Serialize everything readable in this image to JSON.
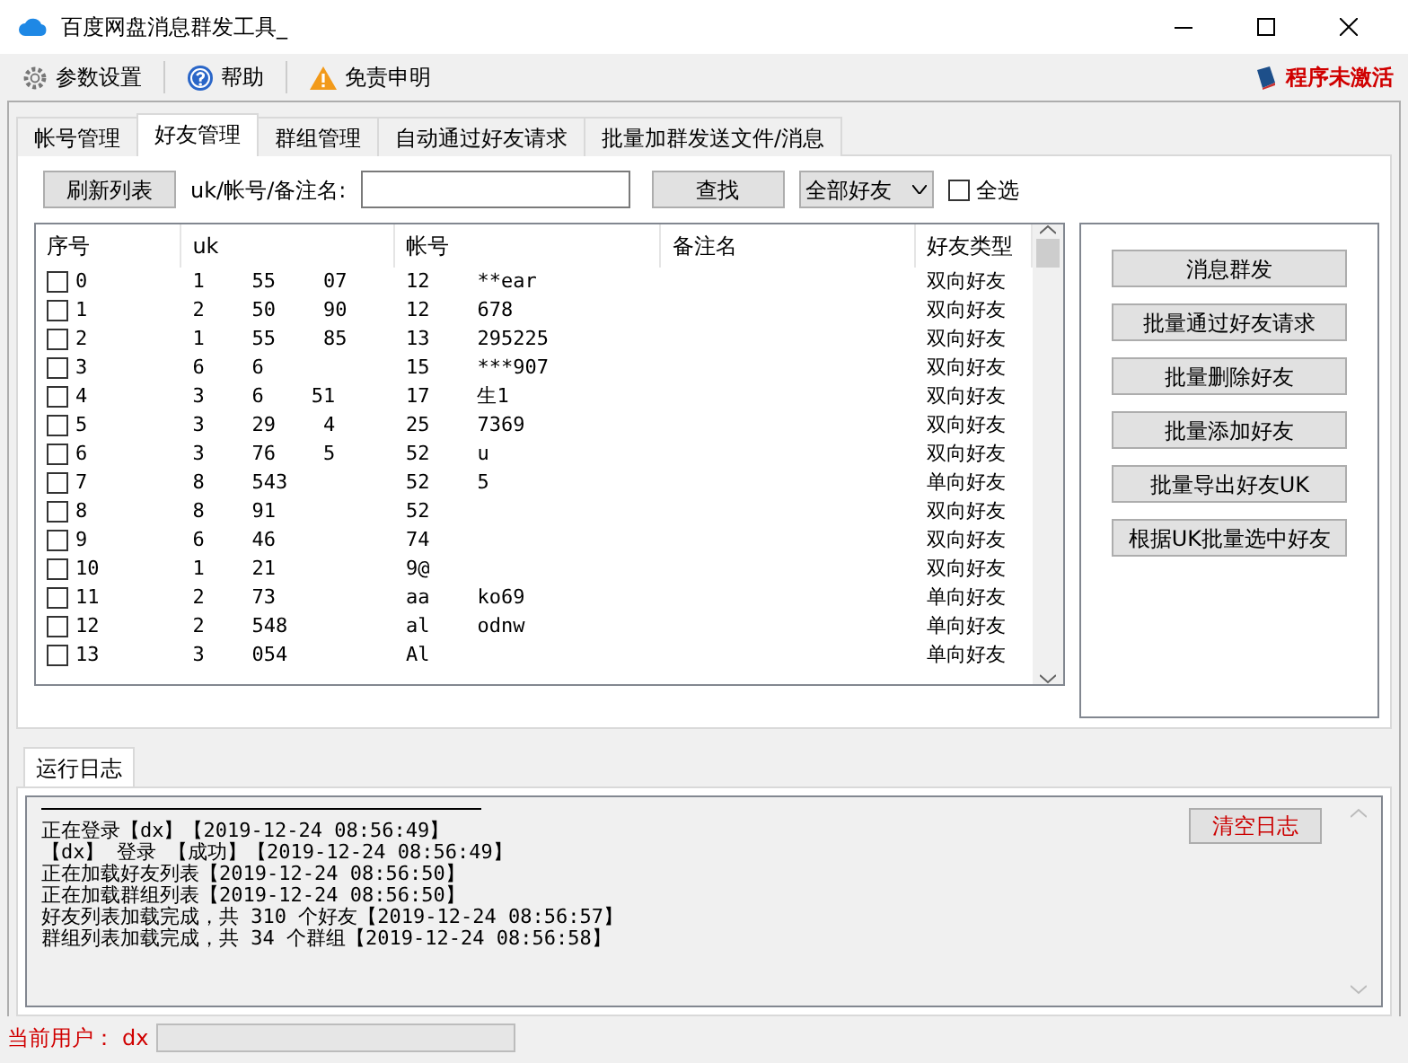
{
  "window": {
    "title": "百度网盘消息群发工具_"
  },
  "toolbar": [
    {
      "kind": "gear",
      "label": "参数设置"
    },
    {
      "kind": "help",
      "label": "帮助"
    },
    {
      "kind": "warning",
      "label": "免责申明"
    }
  ],
  "activation": {
    "label": "程序未激活"
  },
  "tabs": [
    {
      "label": "帐号管理",
      "selected": false
    },
    {
      "label": "好友管理",
      "selected": true
    },
    {
      "label": "群组管理",
      "selected": false
    },
    {
      "label": "自动通过好友请求",
      "selected": false
    },
    {
      "label": "批量加群发送文件/消息",
      "selected": false
    }
  ],
  "search_bar": {
    "refresh_button": "刷新列表",
    "label": "uk/帐号/备注名:",
    "search_button": "查找",
    "filter": "全部好友",
    "select_all": {
      "label": "全选",
      "checked": false
    }
  },
  "table": {
    "columns": [
      "序号",
      "uk",
      "帐号",
      "备注名",
      "好友类型"
    ],
    "rows": [
      {
        "checked": false,
        "cells": [
          "0",
          "1    55    07",
          "12    **ear",
          "",
          "双向好友"
        ]
      },
      {
        "checked": false,
        "cells": [
          "1",
          "2    50    90",
          "12    678",
          "",
          "双向好友"
        ]
      },
      {
        "checked": false,
        "cells": [
          "2",
          "1    55    85",
          "13    295225",
          "",
          "双向好友"
        ]
      },
      {
        "checked": false,
        "cells": [
          "3",
          "6    6",
          "15    ***907",
          "",
          "双向好友"
        ]
      },
      {
        "checked": false,
        "cells": [
          "4",
          "3    6    51",
          "17    生1",
          "",
          "双向好友"
        ]
      },
      {
        "checked": false,
        "cells": [
          "5",
          "3    29    4",
          "25    7369",
          "",
          "双向好友"
        ]
      },
      {
        "checked": false,
        "cells": [
          "6",
          "3    76    5",
          "52    u",
          "",
          "双向好友"
        ]
      },
      {
        "checked": false,
        "cells": [
          "7",
          "8    543",
          "52    5",
          "",
          "单向好友"
        ]
      },
      {
        "checked": false,
        "cells": [
          "8",
          "8    91",
          "52",
          "",
          "双向好友"
        ]
      },
      {
        "checked": false,
        "cells": [
          "9",
          "6    46",
          "74",
          "",
          "双向好友"
        ]
      },
      {
        "checked": false,
        "cells": [
          "10",
          "1    21",
          "9@",
          "",
          "双向好友"
        ]
      },
      {
        "checked": false,
        "cells": [
          "11",
          "2    73",
          "aa    ko69",
          "",
          "单向好友"
        ]
      },
      {
        "checked": false,
        "cells": [
          "12",
          "2    548",
          "al    odnw",
          "",
          "单向好友"
        ]
      },
      {
        "checked": false,
        "cells": [
          "13",
          "3    054",
          "Al",
          "",
          "单向好友"
        ]
      }
    ]
  },
  "actions": [
    "消息群发",
    "批量通过好友请求",
    "批量删除好友",
    "批量添加好友",
    "批量导出好友UK",
    "根据UK批量选中好友"
  ],
  "log": {
    "tab": "运行日志",
    "clear_button": "清空日志",
    "lines": [
      "正在登录【dx】【2019-12-24 08:56:49】",
      "【dx】 登录 【成功】【2019-12-24 08:56:49】",
      "正在加载好友列表【2019-12-24 08:56:50】",
      "正在加载群组列表【2019-12-24 08:56:50】",
      "好友列表加载完成，共 310 个好友【2019-12-24 08:56:57】",
      "群组列表加载完成，共 34 个群组【2019-12-24 08:56:58】"
    ]
  },
  "status_bar": {
    "label": "当前用户：",
    "user": "dx",
    "progress": {
      "level": 0
    }
  }
}
